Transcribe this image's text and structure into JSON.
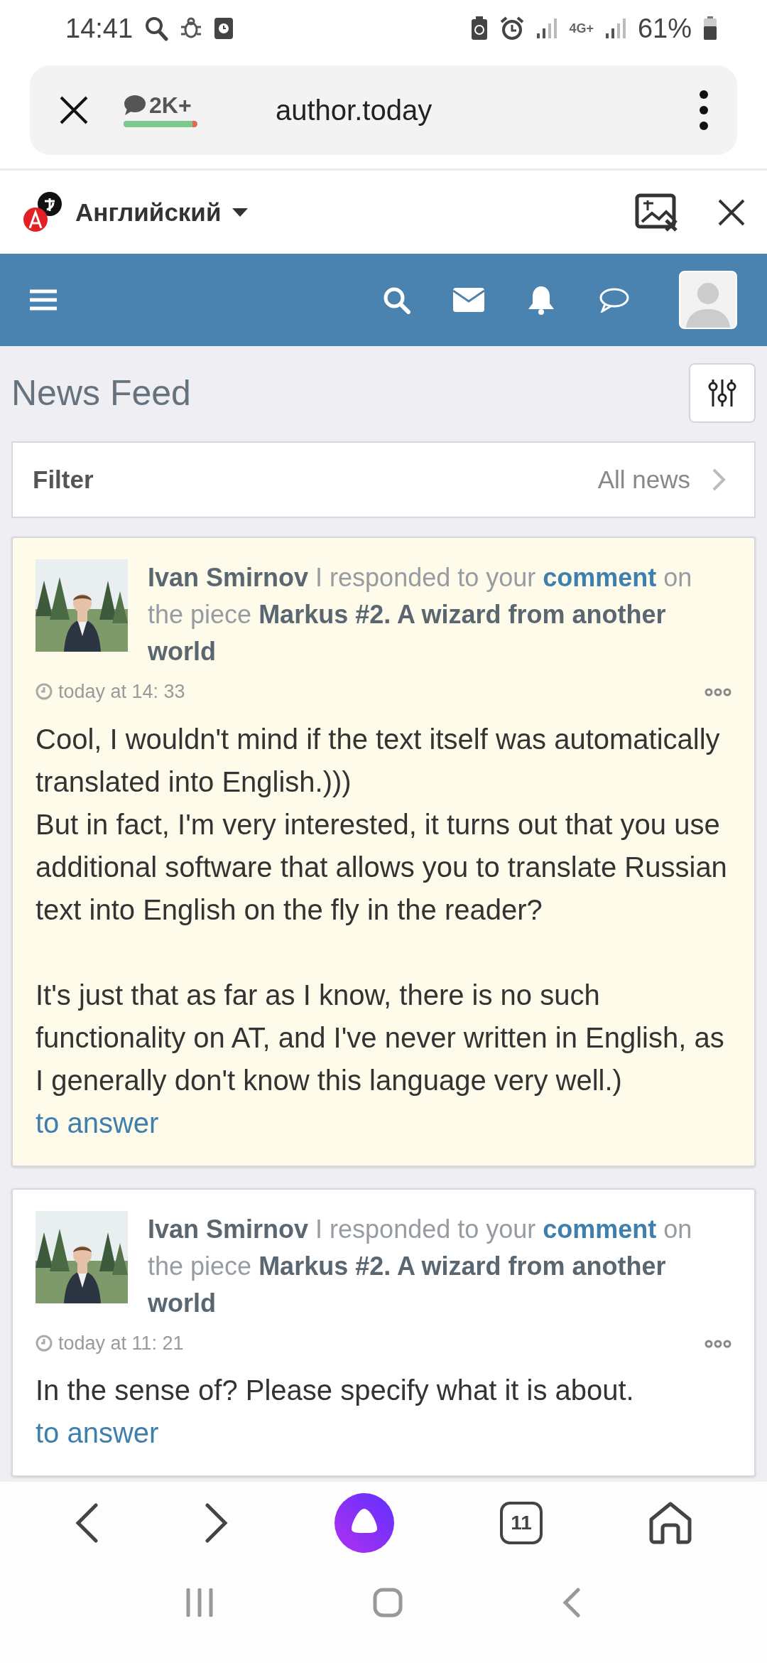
{
  "status_bar": {
    "time": "14:41",
    "network": "4G+",
    "battery": "61%"
  },
  "browser": {
    "comments_badge": "2K+",
    "comments_meter": {
      "level": 0.93
    },
    "url": "author.today",
    "open_tabs": "11"
  },
  "translate_bar": {
    "language": "Английский"
  },
  "page": {
    "title": "News Feed",
    "filter": {
      "label": "Filter",
      "value": "All news"
    }
  },
  "posts": [
    {
      "highlighted": true,
      "author": "Ivan Smirnov",
      "action": "I responded to your",
      "link": "comment",
      "connector": "on the piece",
      "piece": "Markus #2. A wizard from another world",
      "time": "today at 14: 33",
      "body": "Cool, I wouldn't mind if the text itself was automatically translated into English.)))\nBut in fact, I'm very interested, it turns out that you use additional software that allows you to translate Russian text into English on the fly in the reader?\n\nIt's just that as far as I know, there is no such functionality on AT, and I've never written in English, as I generally don't know this language very well.)",
      "reply": "to answer"
    },
    {
      "highlighted": false,
      "author": "Ivan Smirnov",
      "action": "I responded to your",
      "link": "comment",
      "connector": "on the piece",
      "piece": "Markus #2. A wizard from another world",
      "time": "today at 11: 21",
      "body": "In the sense of? Please specify what it is about.",
      "reply": "to answer"
    }
  ]
}
